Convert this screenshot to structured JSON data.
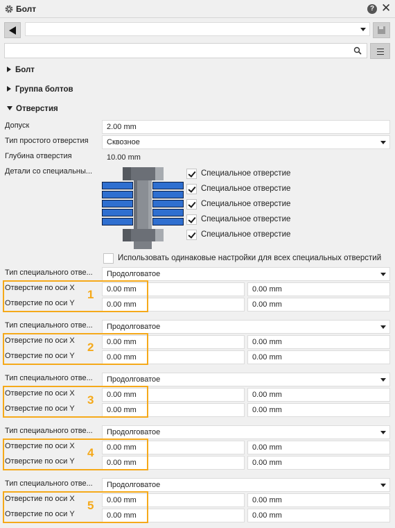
{
  "window": {
    "title": "Болт"
  },
  "toolbar": {
    "combo_value": "",
    "search_value": ""
  },
  "sections": [
    {
      "label": "Болт",
      "expanded": false
    },
    {
      "label": "Группа болтов",
      "expanded": false
    },
    {
      "label": "Отверстия",
      "expanded": true
    }
  ],
  "holes": {
    "tolerance_label": "Допуск",
    "tolerance_value": "2.00 mm",
    "simple_type_label": "Тип простого отверстия",
    "simple_type_value": "Сквозное",
    "depth_label": "Глубина отверстия",
    "depth_value": "10.00 mm",
    "special_parts_label": "Детали со специальны...",
    "special_checks": [
      {
        "label": "Специальное отверстие",
        "checked": true
      },
      {
        "label": "Специальное отверстие",
        "checked": true
      },
      {
        "label": "Специальное отверстие",
        "checked": true
      },
      {
        "label": "Специальное отверстие",
        "checked": true
      },
      {
        "label": "Специальное отверстие",
        "checked": true
      }
    ],
    "same_settings_label": "Использовать одинаковые настройки для всех специальных отверстий",
    "same_settings_checked": false
  },
  "special_groups": [
    {
      "number": "1",
      "type_label": "Тип специального отве...",
      "type_value": "Продолговатое",
      "x_label": "Отверстие по оси X",
      "x_a": "0.00 mm",
      "x_b": "0.00 mm",
      "y_label": "Отверстие по оси Y",
      "y_a": "0.00 mm",
      "y_b": "0.00 mm"
    },
    {
      "number": "2",
      "type_label": "Тип специального отве...",
      "type_value": "Продолговатое",
      "x_label": "Отверстие по оси X",
      "x_a": "0.00 mm",
      "x_b": "0.00 mm",
      "y_label": "Отверстие по оси Y",
      "y_a": "0.00 mm",
      "y_b": "0.00 mm"
    },
    {
      "number": "3",
      "type_label": "Тип специального отве...",
      "type_value": "Продолговатое",
      "x_label": "Отверстие по оси X",
      "x_a": "0.00 mm",
      "x_b": "0.00 mm",
      "y_label": "Отверстие по оси Y",
      "y_a": "0.00 mm",
      "y_b": "0.00 mm"
    },
    {
      "number": "4",
      "type_label": "Тип специального отве...",
      "type_value": "Продолговатое",
      "x_label": "Отверстие по оси X",
      "x_a": "0.00 mm",
      "x_b": "0.00 mm",
      "y_label": "Отверстие по оси Y",
      "y_a": "0.00 mm",
      "y_b": "0.00 mm"
    },
    {
      "number": "5",
      "type_label": "Тип специального отве...",
      "type_value": "Продолговатое",
      "x_label": "Отверстие по оси X",
      "x_a": "0.00 mm",
      "x_b": "0.00 mm",
      "y_label": "Отверстие по оси Y",
      "y_a": "0.00 mm",
      "y_b": "0.00 mm"
    }
  ],
  "colors": {
    "highlight": "#f5a91a",
    "plate_blue": "#2f6fd0",
    "bolt_gray": "#6b6f76"
  }
}
